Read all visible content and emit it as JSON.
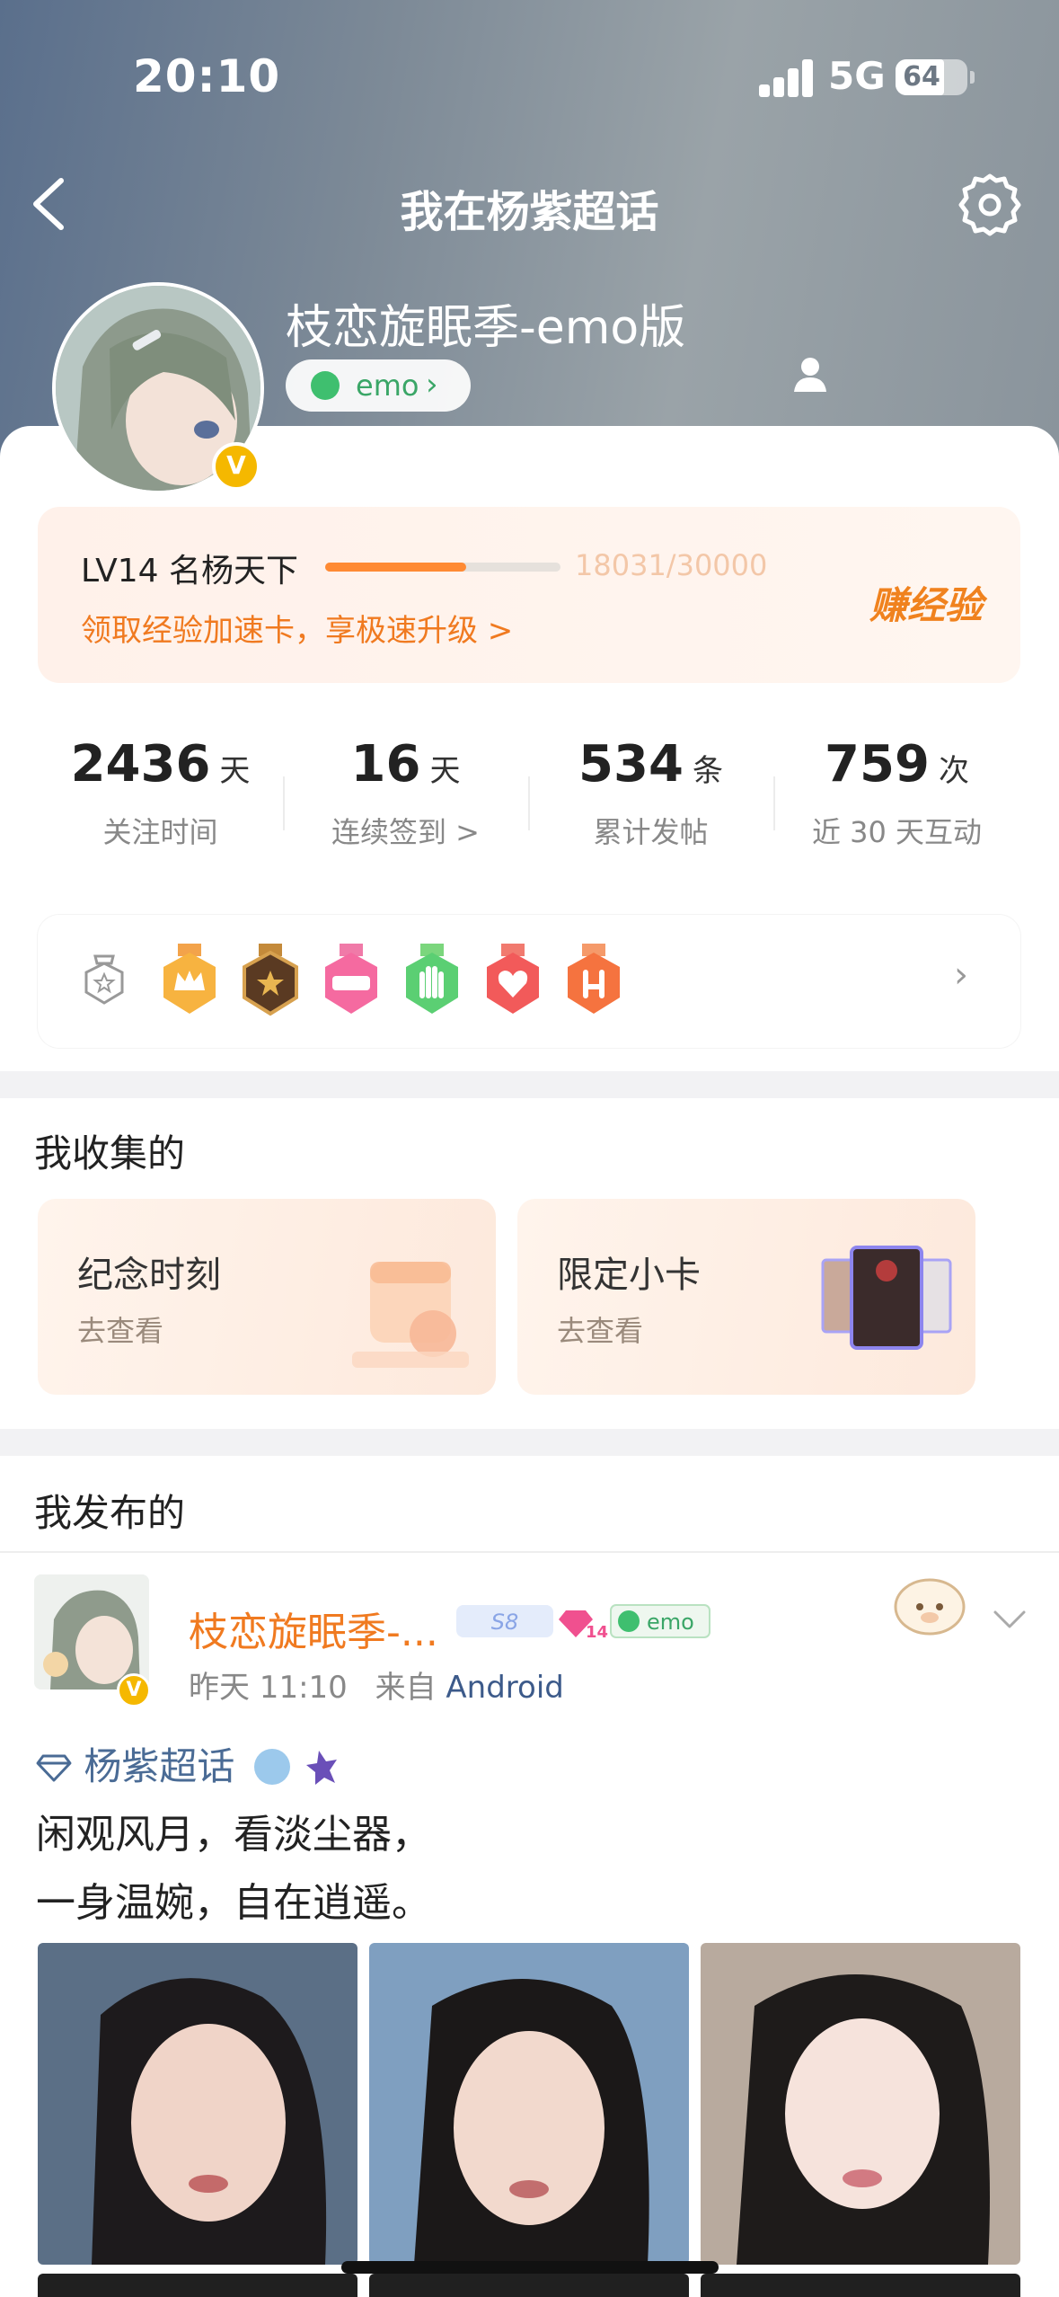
{
  "status_bar": {
    "time": "20:10",
    "network": "5G",
    "battery": "64"
  },
  "nav": {
    "title": "我在杨紫超话"
  },
  "profile": {
    "username": "枝恋旋眠季-emo版",
    "mood_label": "emo"
  },
  "experience": {
    "level": "LV14 名杨天下",
    "progress_text": "18031/30000",
    "progress_fraction": 0.601,
    "promo": "领取经验加速卡，享极速升级 >",
    "earn_button": "赚经验"
  },
  "stats": [
    {
      "value": "2436",
      "unit": "天",
      "label": "关注时间"
    },
    {
      "value": "16",
      "unit": "天",
      "label": "连续签到 >"
    },
    {
      "value": "534",
      "unit": "条",
      "label": "累计发帖"
    },
    {
      "value": "759",
      "unit": "次",
      "label": "近 30 天互动"
    }
  ],
  "medals": [
    "crown-medal",
    "super-medal",
    "lv14-medal",
    "hand-medal",
    "heart-medal",
    "gesture-medal"
  ],
  "collected": {
    "section_title": "我收集的",
    "cards": [
      {
        "title": "纪念时刻",
        "subtitle": "去查看"
      },
      {
        "title": "限定小卡",
        "subtitle": "去查看"
      }
    ]
  },
  "published": {
    "section_title": "我发布的",
    "post": {
      "author": "枝恋旋眠季-...",
      "time": "昨天 11:10",
      "source_prefix": "来自",
      "source": "Android",
      "level_tag": "14",
      "mood_tag": "emo",
      "topic": "杨紫超话",
      "lines": [
        "闲观风月，看淡尘器，",
        "一身温婉，自在逍遥。"
      ]
    }
  },
  "colors": {
    "accent": "#f07a20",
    "link": "#4a6b95",
    "mood": "#3fbf6f",
    "badge": "#f5b800"
  }
}
